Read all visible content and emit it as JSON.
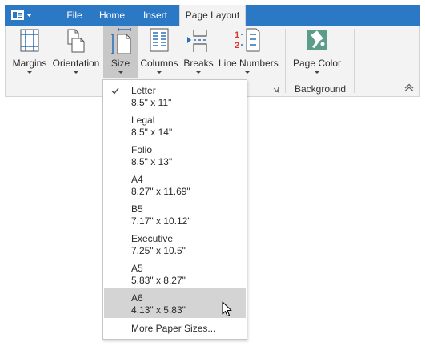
{
  "tabs": [
    {
      "label": "File"
    },
    {
      "label": "Home"
    },
    {
      "label": "Insert"
    },
    {
      "label": "Page Layout",
      "active": true
    }
  ],
  "ribbon": {
    "buttons": [
      {
        "label": "Margins"
      },
      {
        "label": "Orientation"
      },
      {
        "label": "Size",
        "pressed": true
      },
      {
        "label": "Columns"
      },
      {
        "label": "Breaks"
      },
      {
        "label": "Line Numbers"
      },
      {
        "label": "Page Color"
      }
    ],
    "line_numbers_glyphs": [
      "1",
      "2"
    ],
    "groups": [
      {
        "label": "Background"
      }
    ]
  },
  "size_menu": {
    "items": [
      {
        "name": "Letter",
        "dims": "8.5\" x 11\"",
        "checked": true
      },
      {
        "name": "Legal",
        "dims": "8.5\" x 14\""
      },
      {
        "name": "Folio",
        "dims": "8.5\" x 13\""
      },
      {
        "name": "A4",
        "dims": "8.27\" x 11.69\""
      },
      {
        "name": "B5",
        "dims": "7.17\" x 10.12\""
      },
      {
        "name": "Executive",
        "dims": "7.25\" x 10.5\""
      },
      {
        "name": "A5",
        "dims": "5.83\" x 8.27\""
      },
      {
        "name": "A6",
        "dims": "4.13\" x 5.83\"",
        "hovered": true
      }
    ],
    "more_label": "More Paper Sizes..."
  },
  "colors": {
    "tab_bar": "#2b78c5",
    "ribbon_bg": "#f3f3f3",
    "pressed": "#c8c8c8",
    "hover": "#d4d4d4",
    "icon_blue": "#2b6fb7",
    "page_color_green": "#5c9c8a",
    "line_numbers_red": "#d83b2a"
  },
  "icons": [
    "app-menu-icon",
    "margins-icon",
    "orientation-icon",
    "size-icon",
    "columns-icon",
    "breaks-icon",
    "line-numbers-icon",
    "page-color-icon",
    "dialog-launcher-icon",
    "collapse-ribbon-icon",
    "checkmark-icon",
    "mouse-cursor-icon"
  ]
}
